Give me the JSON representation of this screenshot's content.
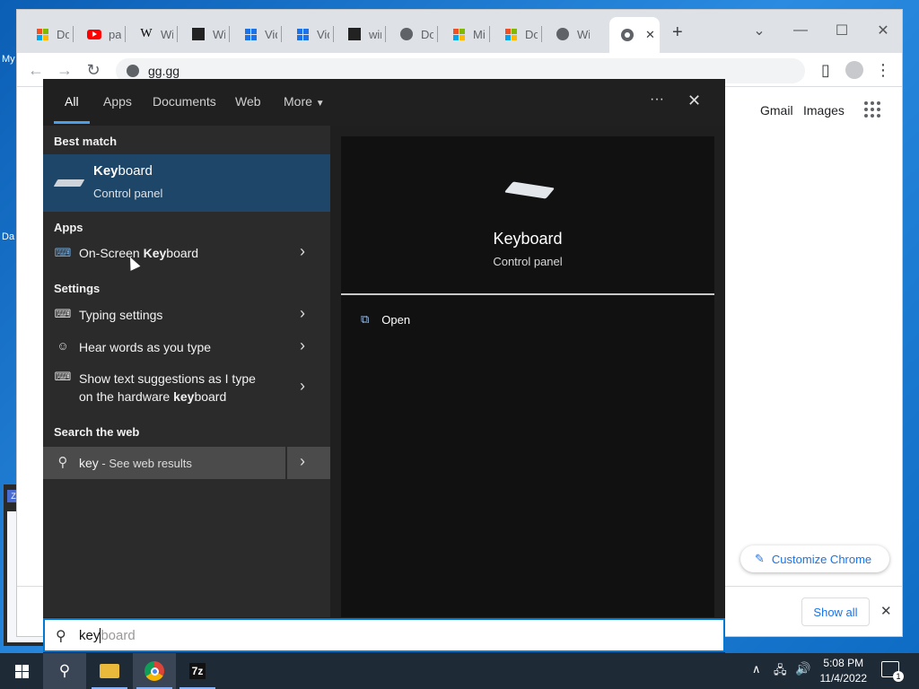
{
  "desktop": {
    "icon_labels": [
      "My",
      "Da"
    ],
    "thumbnail_title": "Wi"
  },
  "chrome": {
    "tabs": [
      {
        "title": "Dov",
        "icon": "microsoft-icon"
      },
      {
        "title": "pal",
        "icon": "youtube-icon"
      },
      {
        "title": "Wi",
        "icon": "wikipedia-icon"
      },
      {
        "title": "Wi",
        "icon": "archive-icon"
      },
      {
        "title": "Vid",
        "icon": "windows-icon"
      },
      {
        "title": "Vid",
        "icon": "windows-icon"
      },
      {
        "title": "win",
        "icon": "archive-icon"
      },
      {
        "title": "Do",
        "icon": "globe-icon"
      },
      {
        "title": "Mic",
        "icon": "microsoft-icon"
      },
      {
        "title": "Do",
        "icon": "microsoft-icon"
      },
      {
        "title": "Wi",
        "icon": "globe-icon"
      }
    ],
    "active_tab_close": "✕",
    "new_tab": "+",
    "url": "gg.gg",
    "header_links": [
      "Gmail",
      "Images"
    ],
    "customize_label": "Customize Chrome",
    "download_bar": {
      "show_all": "Show all",
      "close": "✕"
    }
  },
  "search_panel": {
    "tabs": [
      "All",
      "Apps",
      "Documents",
      "Web",
      "More"
    ],
    "more_menu": "···",
    "close": "✕",
    "best_match_header": "Best match",
    "best_match": {
      "title_bold": "Key",
      "title_rest": "board",
      "subtitle": "Control panel"
    },
    "apps_header": "Apps",
    "apps": [
      {
        "pre": "On-Screen ",
        "bold": "Key",
        "post": "board"
      }
    ],
    "settings_header": "Settings",
    "settings": [
      {
        "label": "Typing settings"
      },
      {
        "label": "Hear words as you type"
      },
      {
        "line1": "Show text suggestions as I type",
        "line2_pre": "on the hardware ",
        "line2_bold": "key",
        "line2_post": "board"
      }
    ],
    "web_header": "Search the web",
    "web_query": "key",
    "web_suffix": " - See web results",
    "preview": {
      "title": "Keyboard",
      "subtitle": "Control panel",
      "open_action": "Open"
    },
    "search_box": {
      "typed": "key",
      "completion": "board"
    }
  },
  "taskbar": {
    "time": "5:08 PM",
    "date": "11/4/2022",
    "notification_count": "1",
    "app_7zip": "7z"
  }
}
